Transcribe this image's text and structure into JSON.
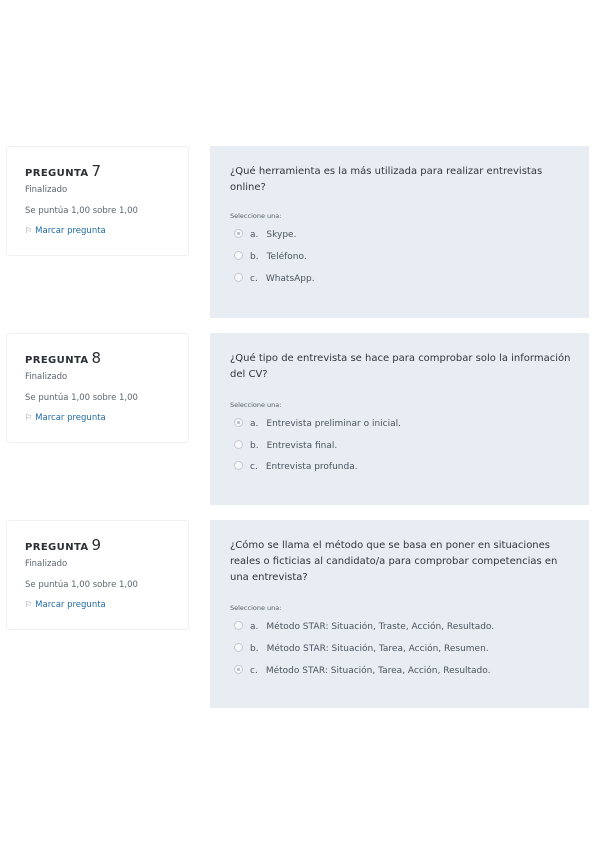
{
  "questions": [
    {
      "label": "PREGUNTA",
      "number": "7",
      "state": "Finalizado",
      "grade": "Se puntúa 1,00 sobre 1,00",
      "flag_label": "Marcar pregunta",
      "text": "¿Qué herramienta es la más utilizada para realizar entrevistas online?",
      "prompt": "Seleccione una:",
      "options": [
        {
          "letter": "a.",
          "text": "Skype.",
          "selected": true
        },
        {
          "letter": "b.",
          "text": "Teléfono.",
          "selected": false
        },
        {
          "letter": "c.",
          "text": "WhatsApp.",
          "selected": false
        }
      ]
    },
    {
      "label": "PREGUNTA",
      "number": "8",
      "state": "Finalizado",
      "grade": "Se puntúa 1,00 sobre 1,00",
      "flag_label": "Marcar pregunta",
      "text": "¿Qué tipo de entrevista se hace para comprobar solo la información del CV?",
      "prompt": "Seleccione una:",
      "options": [
        {
          "letter": "a.",
          "text": "Entrevista preliminar o inicial.",
          "selected": true
        },
        {
          "letter": "b.",
          "text": "Entrevista final.",
          "selected": false
        },
        {
          "letter": "c.",
          "text": "Entrevista profunda.",
          "selected": false
        }
      ]
    },
    {
      "label": "PREGUNTA",
      "number": "9",
      "state": "Finalizado",
      "grade": "Se puntúa 1,00 sobre 1,00",
      "flag_label": "Marcar pregunta",
      "text": "¿Cómo se llama el método que se basa en poner en situaciones reales o ficticias al candidato/a para comprobar competencias en una entrevista?",
      "prompt": "Seleccione una:",
      "options": [
        {
          "letter": "a.",
          "text": "Método STAR: Situación, Traste, Acción, Resultado.",
          "selected": false
        },
        {
          "letter": "b.",
          "text": "Método STAR: Situación, Tarea, Acción, Resumen.",
          "selected": false
        },
        {
          "letter": "c.",
          "text": "Método STAR: Situación, Tarea, Acción, Resultado.",
          "selected": true
        }
      ]
    }
  ]
}
